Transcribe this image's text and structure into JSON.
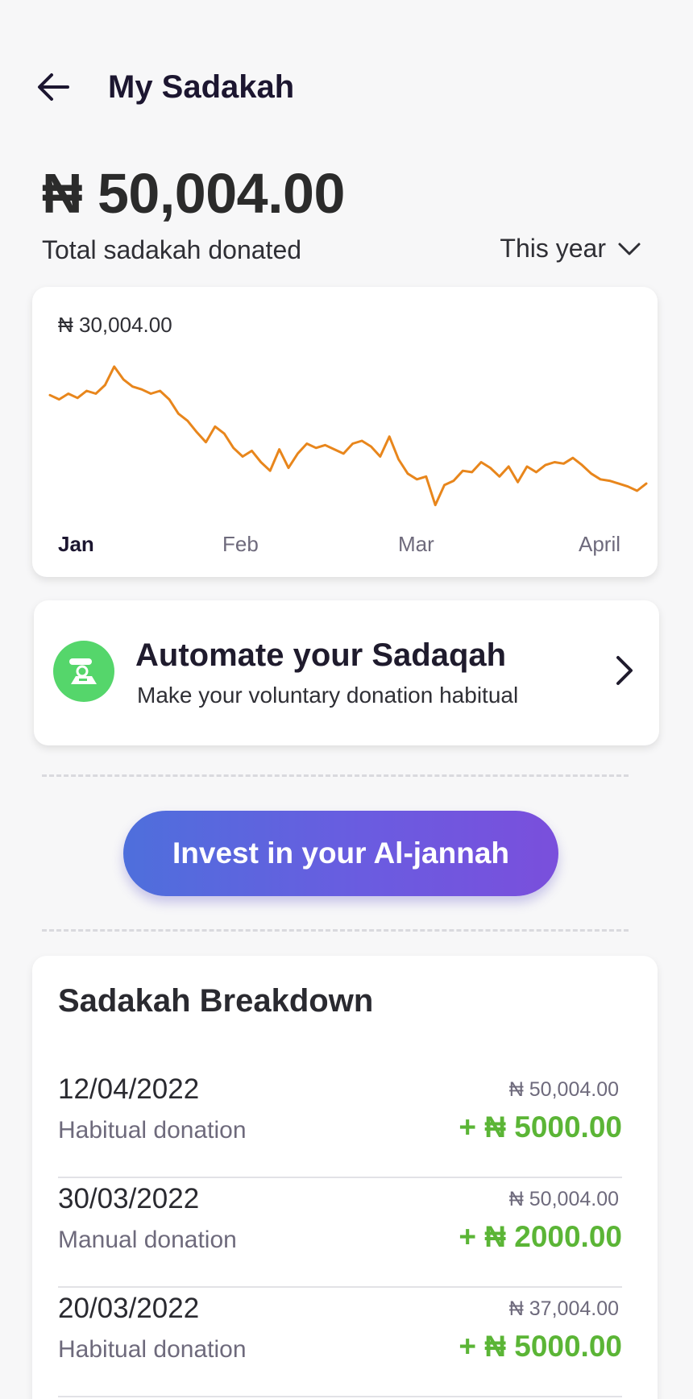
{
  "header": {
    "title": "My Sadakah",
    "back_icon": "arrow-left-icon"
  },
  "summary": {
    "total": "₦ 50,004.00",
    "label": "Total sadakah donated",
    "period": "This year",
    "period_icon": "chevron-down-icon"
  },
  "chart_data": {
    "type": "line",
    "title": "",
    "max_label": "₦ 30,004.00",
    "x_ticks": [
      "Jan",
      "Feb",
      "Mar",
      "April"
    ],
    "color": "#e8861c",
    "series": [
      {
        "values": [
          0.65,
          0.62,
          0.66,
          0.63,
          0.68,
          0.66,
          0.72,
          0.85,
          0.76,
          0.71,
          0.69,
          0.66,
          0.68,
          0.62,
          0.52,
          0.47,
          0.39,
          0.32,
          0.43,
          0.38,
          0.28,
          0.22,
          0.26,
          0.18,
          0.12,
          0.27,
          0.14,
          0.24,
          0.31,
          0.28,
          0.3,
          0.27,
          0.24,
          0.31,
          0.33,
          0.29,
          0.22,
          0.36,
          0.2,
          0.1,
          0.06,
          0.08,
          -0.12,
          0.02,
          0.05,
          0.12,
          0.11,
          0.18,
          0.14,
          0.08,
          0.15,
          0.04,
          0.15,
          0.11,
          0.16,
          0.18,
          0.17,
          0.21,
          0.16,
          0.1,
          0.06,
          0.05,
          0.03,
          0.01,
          -0.02,
          0.03
        ]
      }
    ]
  },
  "automate": {
    "title": "Automate your Sadaqah",
    "subtitle": "Make your voluntary donation habitual",
    "icon": "hand-coin-icon",
    "chevron": "chevron-right-icon"
  },
  "cta": {
    "label": "Invest in your Al-jannah"
  },
  "breakdown": {
    "title": "Sadakah Breakdown",
    "rows": [
      {
        "date": "12/04/2022",
        "type": "Habitual donation",
        "total": "₦ 50,004.00",
        "amount": "+ ₦ 5000.00"
      },
      {
        "date": "30/03/2022",
        "type": "Manual donation",
        "total": "₦ 50,004.00",
        "amount": "+ ₦ 2000.00"
      },
      {
        "date": "20/03/2022",
        "type": "Habitual donation",
        "total": "₦ 37,004.00",
        "amount": "+ ₦ 5000.00"
      }
    ]
  },
  "colors": {
    "accent_green": "#5bb536",
    "chart_line": "#e8861c",
    "cta_start": "#4e6fdc",
    "cta_end": "#7a4fdc"
  }
}
